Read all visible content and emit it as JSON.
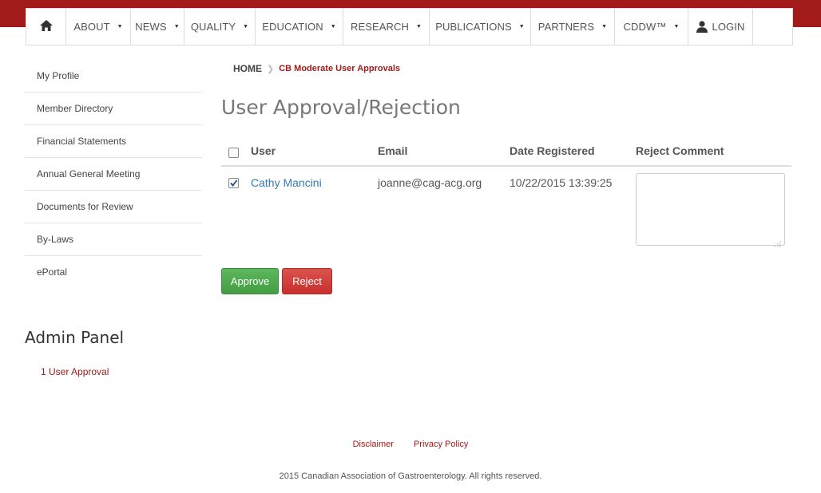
{
  "nav": {
    "items": [
      {
        "label": "ABOUT"
      },
      {
        "label": "NEWS"
      },
      {
        "label": "QUALITY"
      },
      {
        "label": "EDUCATION"
      },
      {
        "label": "RESEARCH"
      },
      {
        "label": "PUBLICATIONS"
      },
      {
        "label": "PARTNERS"
      },
      {
        "label": "CDDW™"
      }
    ],
    "login_label": "LOGIN"
  },
  "sidebar": {
    "items": [
      {
        "label": "My Profile"
      },
      {
        "label": "Member Directory"
      },
      {
        "label": "Financial Statements"
      },
      {
        "label": "Annual General Meeting"
      },
      {
        "label": "Documents for Review"
      },
      {
        "label": "By-Laws"
      },
      {
        "label": "ePortal"
      }
    ]
  },
  "admin": {
    "title": "Admin Panel",
    "link": "1 User Approval"
  },
  "breadcrumb": {
    "home": "HOME",
    "current": "CB Moderate User Approvals"
  },
  "page_title": "User Approval/Rejection",
  "table": {
    "headers": {
      "user": "User",
      "email": "Email",
      "date": "Date Registered",
      "comment": "Reject Comment"
    },
    "rows": [
      {
        "user": "Cathy Mancini",
        "email": "joanne@cag-acg.org",
        "date": "10/22/2015 13:39:25",
        "comment": "",
        "checked": true
      }
    ]
  },
  "buttons": {
    "approve": "Approve",
    "reject": "Reject"
  },
  "footer": {
    "disclaimer": "Disclaimer",
    "privacy": "Privacy Policy",
    "copyright": "2015 Canadian Association of Gastroenterology. All rights reserved."
  },
  "colors": {
    "brand": "#a31a1a",
    "link": "#337ab7",
    "approve": "#5cb85c",
    "reject": "#d9534f"
  },
  "icons": {
    "home": "home-icon",
    "login": "user-icon",
    "caret": "caret-down-icon",
    "breadcrumb_sep": "chevron-right-icon"
  }
}
